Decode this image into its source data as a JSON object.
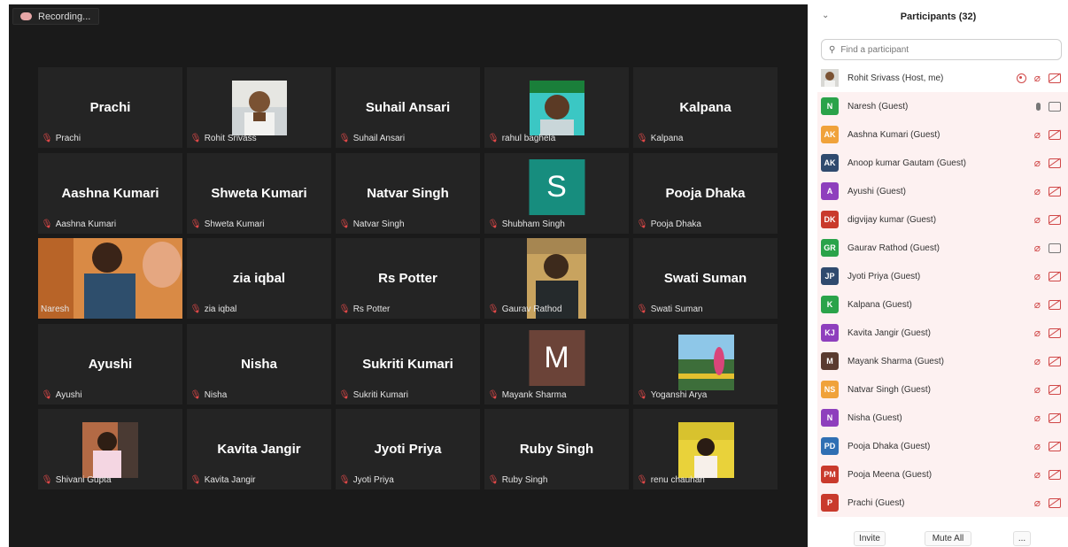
{
  "recording": {
    "label": "Recording..."
  },
  "gallery": [
    {
      "caption": "Prachi",
      "bigname": "Prachi"
    },
    {
      "caption": "Rohit Srivass",
      "bigname": ""
    },
    {
      "caption": "Suhail Ansari",
      "bigname": "Suhail Ansari"
    },
    {
      "caption": "rahul baghela",
      "bigname": ""
    },
    {
      "caption": "Kalpana",
      "bigname": "Kalpana"
    },
    {
      "caption": "Aashna Kumari",
      "bigname": "Aashna Kumari"
    },
    {
      "caption": "Shweta Kumari",
      "bigname": "Shweta Kumari"
    },
    {
      "caption": "Natvar Singh",
      "bigname": "Natvar Singh"
    },
    {
      "caption": "Shubham Singh",
      "bigname": "",
      "avatar_letter": "S",
      "avatar_color": "#178d7e"
    },
    {
      "caption": "Pooja Dhaka",
      "bigname": "Pooja Dhaka"
    },
    {
      "caption": "Naresh",
      "bigname": ""
    },
    {
      "caption": "zia iqbal",
      "bigname": "zia iqbal"
    },
    {
      "caption": "Rs Potter",
      "bigname": "Rs Potter"
    },
    {
      "caption": "Gaurav Rathod",
      "bigname": ""
    },
    {
      "caption": "Swati Suman",
      "bigname": "Swati Suman"
    },
    {
      "caption": "Ayushi",
      "bigname": "Ayushi"
    },
    {
      "caption": "Nisha",
      "bigname": "Nisha"
    },
    {
      "caption": "Sukriti Kumari",
      "bigname": "Sukriti Kumari"
    },
    {
      "caption": "Mayank Sharma",
      "bigname": "",
      "avatar_letter": "M",
      "avatar_color": "#6b4338"
    },
    {
      "caption": "Yoganshi Arya",
      "bigname": ""
    },
    {
      "caption": "Shivani Gupta",
      "bigname": ""
    },
    {
      "caption": "Kavita Jangir",
      "bigname": "Kavita Jangir"
    },
    {
      "caption": "Jyoti Priya",
      "bigname": "Jyoti Priya"
    },
    {
      "caption": "Ruby Singh",
      "bigname": "Ruby Singh"
    },
    {
      "caption": "renu chauhan",
      "bigname": ""
    }
  ],
  "panel": {
    "title": "Participants (32)",
    "search_placeholder": "Find a participant",
    "participants": [
      {
        "initials": "",
        "color": "#8a6d55",
        "name": "Rohit Srivass (Host, me)",
        "icons": [
          "share",
          "micoff",
          "vidoff"
        ],
        "is_photo": true
      },
      {
        "initials": "N",
        "color": "#2aa34a",
        "name": "Naresh (Guest)",
        "icons": [
          "mic",
          "vid"
        ]
      },
      {
        "initials": "AK",
        "color": "#f0a23a",
        "name": "Aashna Kumari (Guest)",
        "icons": [
          "micoff",
          "vidoff"
        ]
      },
      {
        "initials": "AK",
        "color": "#2f4a6e",
        "name": "Anoop kumar Gautam (Guest)",
        "icons": [
          "micoff",
          "vidoff"
        ]
      },
      {
        "initials": "A",
        "color": "#8e3fbd",
        "name": "Ayushi (Guest)",
        "icons": [
          "micoff",
          "vidoff"
        ]
      },
      {
        "initials": "DK",
        "color": "#c93a2c",
        "name": "digvijay kumar (Guest)",
        "icons": [
          "micoff",
          "vidoff"
        ]
      },
      {
        "initials": "GR",
        "color": "#2aa34a",
        "name": "Gaurav Rathod (Guest)",
        "icons": [
          "micoff",
          "vid"
        ]
      },
      {
        "initials": "JP",
        "color": "#2f4a6e",
        "name": "Jyoti Priya (Guest)",
        "icons": [
          "micoff",
          "vidoff"
        ]
      },
      {
        "initials": "K",
        "color": "#2aa34a",
        "name": "Kalpana (Guest)",
        "icons": [
          "micoff",
          "vidoff"
        ]
      },
      {
        "initials": "KJ",
        "color": "#8e3fbd",
        "name": "Kavita Jangir (Guest)",
        "icons": [
          "micoff",
          "vidoff"
        ]
      },
      {
        "initials": "M",
        "color": "#5a3b30",
        "name": "Mayank Sharma (Guest)",
        "icons": [
          "micoff",
          "vidoff"
        ]
      },
      {
        "initials": "NS",
        "color": "#f0a23a",
        "name": "Natvar Singh (Guest)",
        "icons": [
          "micoff",
          "vidoff"
        ]
      },
      {
        "initials": "N",
        "color": "#8e3fbd",
        "name": "Nisha (Guest)",
        "icons": [
          "micoff",
          "vidoff"
        ]
      },
      {
        "initials": "PD",
        "color": "#2f6fb3",
        "name": "Pooja Dhaka (Guest)",
        "icons": [
          "micoff",
          "vidoff"
        ]
      },
      {
        "initials": "PM",
        "color": "#c93a2c",
        "name": "Pooja Meena (Guest)",
        "icons": [
          "micoff",
          "vidoff"
        ]
      },
      {
        "initials": "P",
        "color": "#c93a2c",
        "name": "Prachi (Guest)",
        "icons": [
          "micoff",
          "vidoff"
        ]
      }
    ],
    "footer": {
      "invite": "Invite",
      "mute_all": "Mute All",
      "more": "..."
    }
  }
}
